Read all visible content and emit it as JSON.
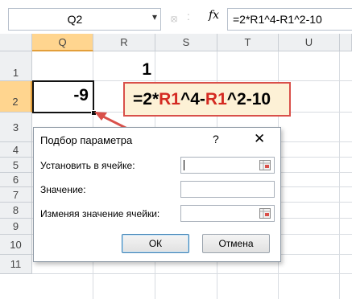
{
  "formula_bar": {
    "name_box": "Q2",
    "name_box_dropdown_icon": "chevron-down-icon",
    "cancel_icon": "cancel-icon",
    "separator": ":",
    "fx_label": "fx",
    "formula": "=2*R1^4-R1^2-10"
  },
  "columns": [
    "Q",
    "R",
    "S",
    "T",
    "U"
  ],
  "rows": [
    "1",
    "2",
    "3",
    "4",
    "5",
    "6",
    "7",
    "8",
    "9",
    "10",
    "11"
  ],
  "cells": {
    "R1": "1",
    "Q2": "-9"
  },
  "active_cell": "Q2",
  "callout": {
    "parts": [
      "=2*",
      "R1",
      "^4-",
      "R1",
      "^2-10"
    ]
  },
  "dialog": {
    "title": "Подбор параметра",
    "help": "?",
    "close": "✕",
    "set_cell_label": "Установить в ячейке:",
    "set_cell_value": "",
    "to_value_label": "Значение:",
    "to_value_value": "",
    "changing_cell_label": "Изменяя значение ячейки:",
    "changing_cell_value": "",
    "ok": "ОК",
    "cancel": "Отмена"
  },
  "colors": {
    "header_bg": "#eef0f2",
    "active_header": "#ffd58f",
    "callout_border": "#d9504a",
    "callout_highlight": "#d42a22"
  }
}
